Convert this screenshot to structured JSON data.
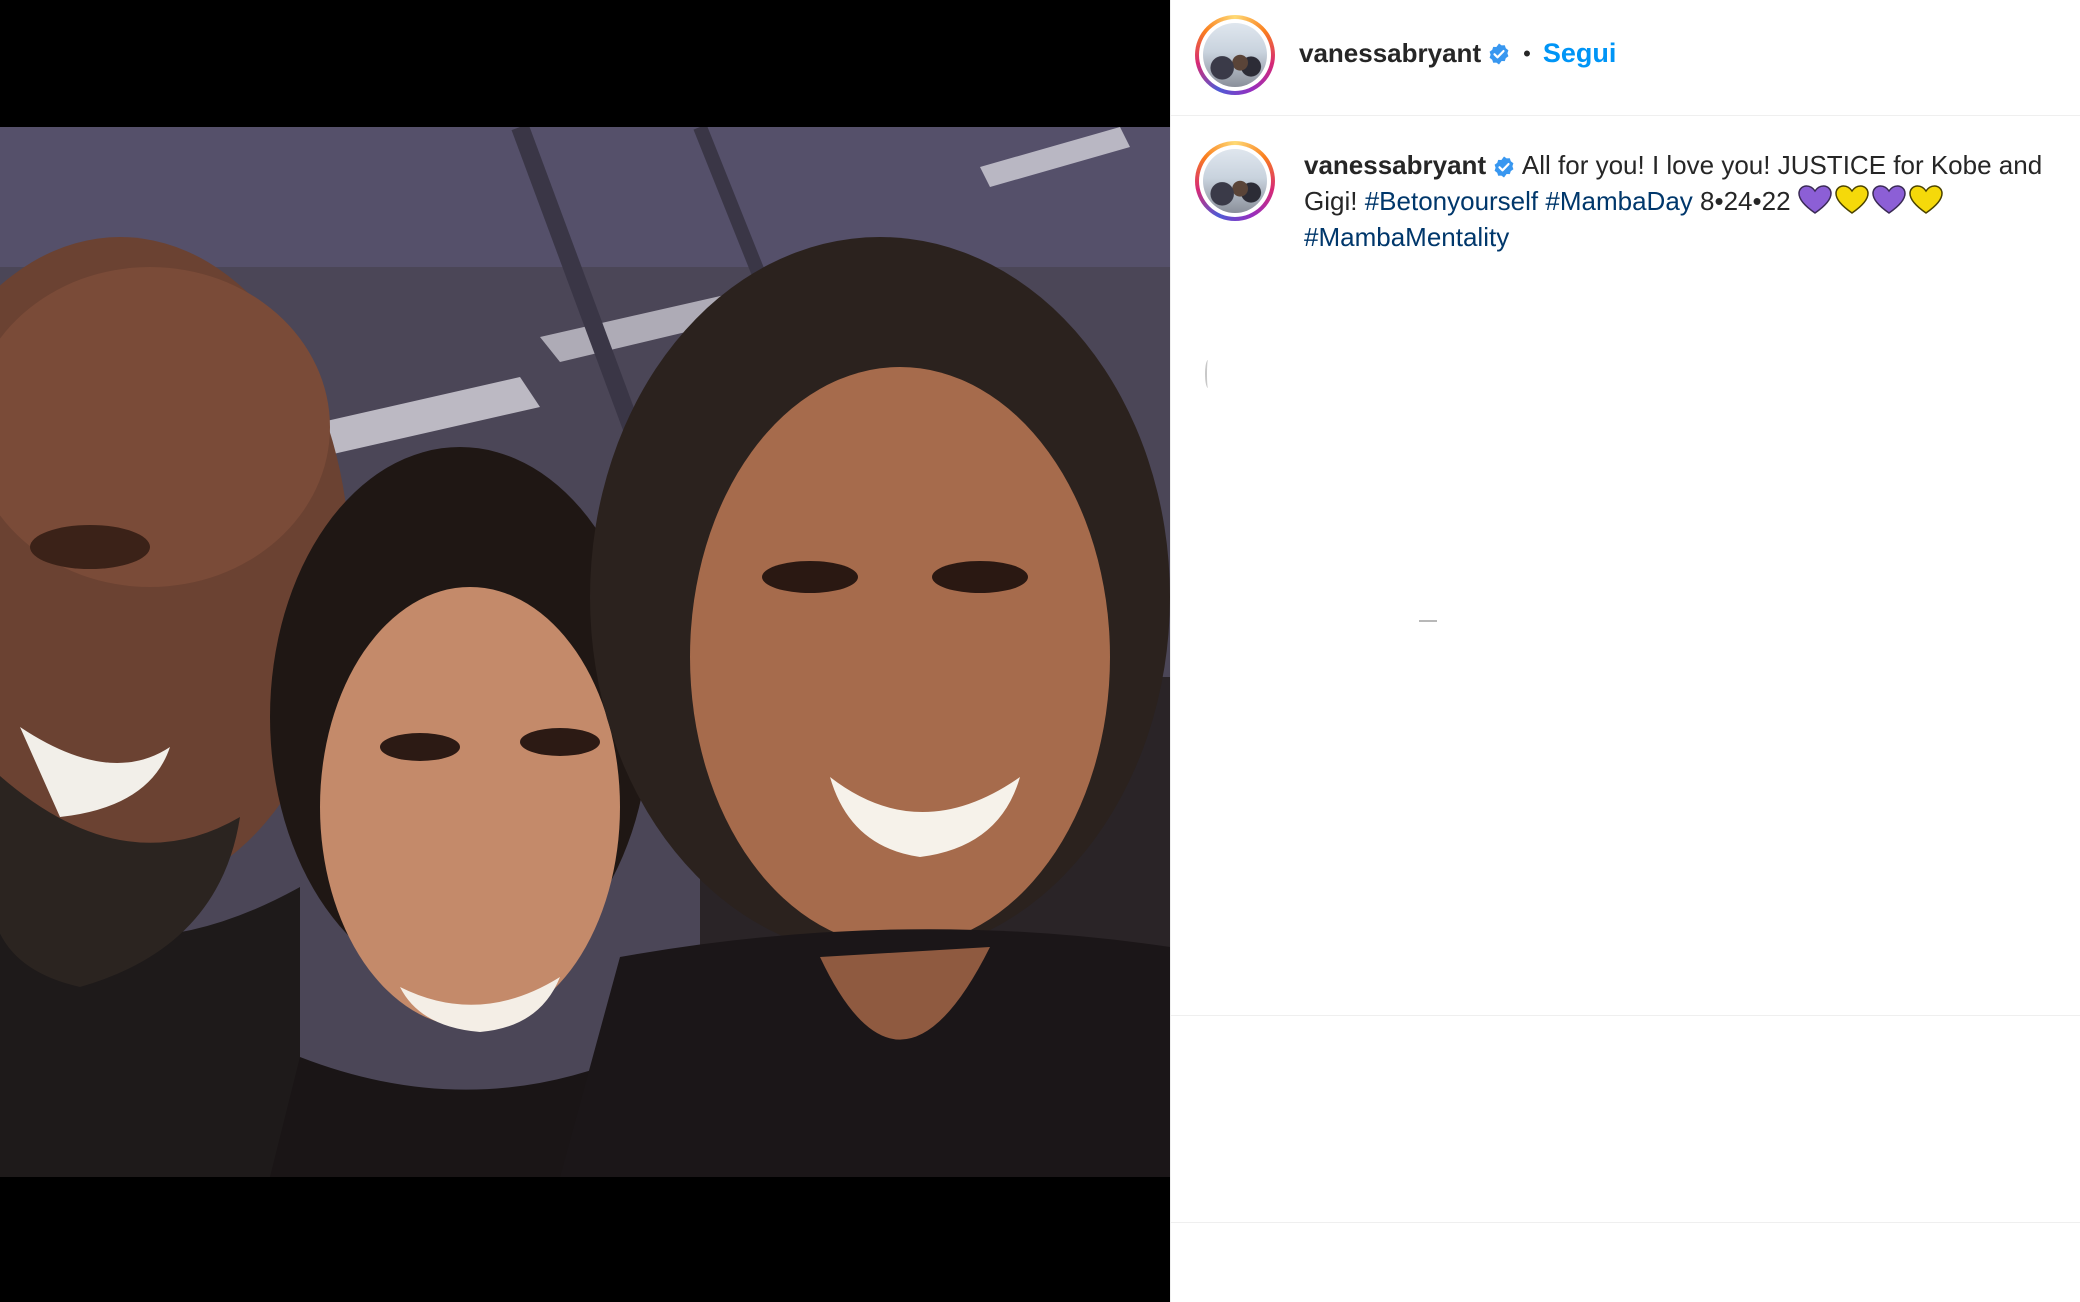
{
  "post": {
    "username": "vanessabryant",
    "verified": true,
    "follow_label": "Segui",
    "separator": "•"
  },
  "caption": {
    "username": "vanessabryant",
    "text_before": "All for you! I love you! JUSTICE for Kobe and Gigi!",
    "hashtag_1": "#Betonyourself",
    "hashtag_2": "#MambaDay",
    "date_text": "8•24•22",
    "hearts": [
      "purple",
      "yellow",
      "purple",
      "yellow"
    ],
    "hashtag_3": "#MambaMentality"
  },
  "colors": {
    "follow_blue": "#0095f6",
    "hashtag_blue": "#00376b",
    "verified_blue": "#3897f0",
    "heart_purple": "#8c5fd6",
    "heart_yellow": "#f5d90a"
  },
  "icons": {
    "verified": "verified-badge-icon",
    "heart_purple": "purple-heart-icon",
    "heart_yellow": "yellow-heart-icon"
  }
}
